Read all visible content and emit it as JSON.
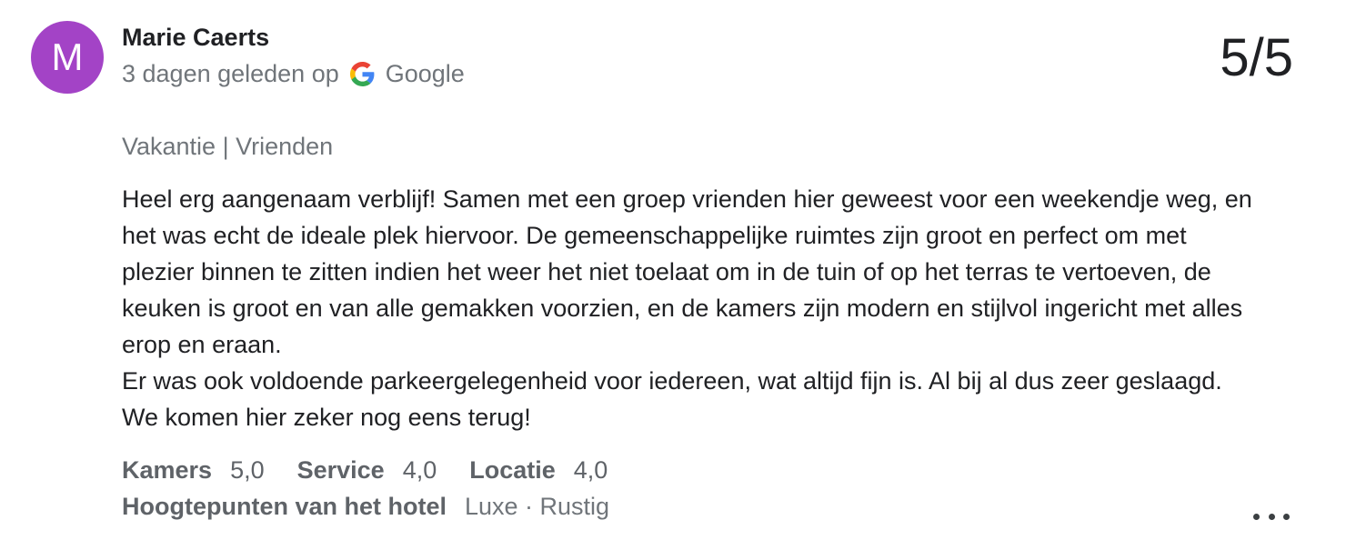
{
  "reviewer": {
    "initial": "M",
    "name": "Marie Caerts",
    "avatar_color": "#a343c6"
  },
  "meta": {
    "time_ago": "3 dagen geleden op",
    "source_icon": "google-g-icon",
    "source": "Google"
  },
  "score": "5/5",
  "trip_type": "Vakantie | Vrienden",
  "review": {
    "paragraphs": [
      "Heel erg aangenaam verblijf! Samen met een groep vrienden hier geweest voor een weekendje weg, en het was echt de ideale plek hiervoor. De gemeenschappelijke ruimtes zijn groot en perfect om met plezier binnen te zitten indien het weer het niet toelaat om in de tuin of op het terras te vertoeven, de keuken is groot en van alle gemakken voorzien, en de kamers zijn modern en stijlvol ingericht met alles erop en eraan.",
      "Er was ook voldoende parkeergelegenheid voor iedereen, wat altijd fijn is. Al bij al dus zeer geslaagd. We komen hier zeker nog eens terug!"
    ]
  },
  "ratings": [
    {
      "label": "Kamers",
      "value": "5,0"
    },
    {
      "label": "Service",
      "value": "4,0"
    },
    {
      "label": "Locatie",
      "value": "4,0"
    }
  ],
  "highlights": {
    "label": "Hoogtepunten van het hotel",
    "value": "Luxe · Rustig"
  },
  "more_icon": "more-horizontal-icon"
}
